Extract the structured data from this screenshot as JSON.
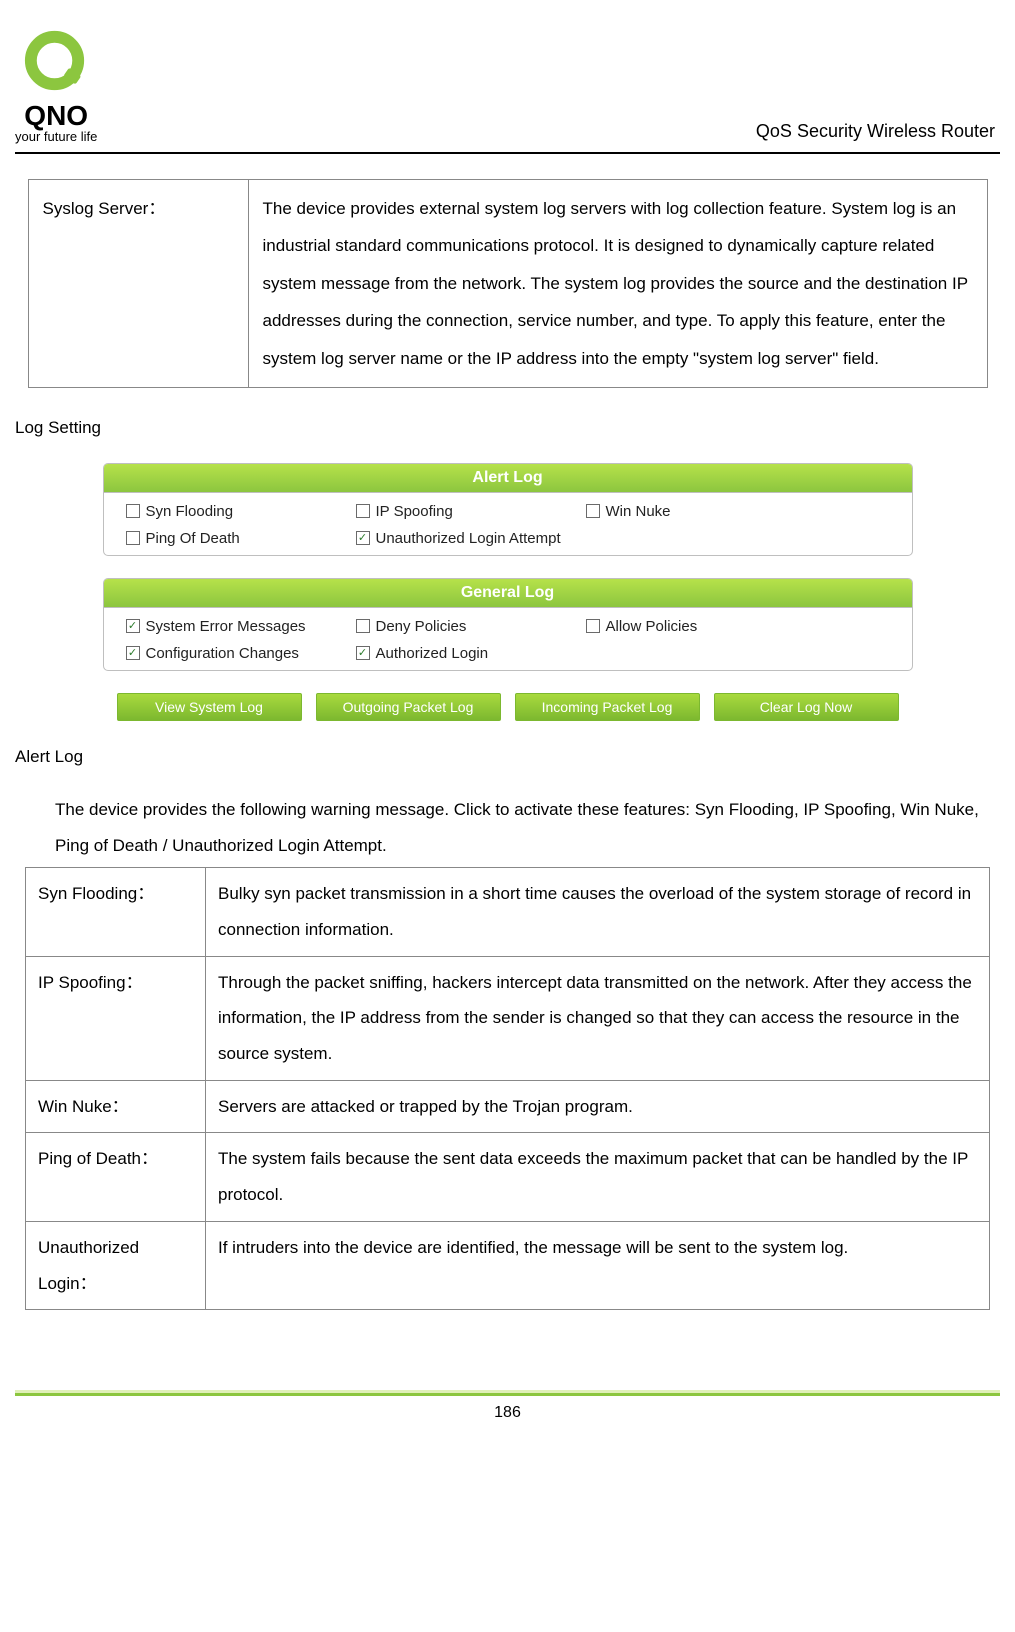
{
  "header": {
    "brand_word": "QNO",
    "tagline": "your future life",
    "title": "QoS Security Wireless Router"
  },
  "syslog_table": {
    "term": "Syslog Server：",
    "desc": "The device provides external system log servers with log collection feature. System log is an industrial standard communications protocol. It is designed to dynamically capture related system message from the network. The system log provides the source and the destination IP addresses during the connection, service number, and type. To apply this feature, enter the system log server name or the IP address into the empty \"system log server\" field."
  },
  "section_log_setting": "Log Setting",
  "alert_panel": {
    "title": "Alert Log",
    "items": [
      {
        "label": "Syn Flooding",
        "checked": false
      },
      {
        "label": "IP Spoofing",
        "checked": false
      },
      {
        "label": "Win Nuke",
        "checked": false
      },
      {
        "label": "Ping Of Death",
        "checked": false
      },
      {
        "label": "Unauthorized Login Attempt",
        "checked": true
      }
    ]
  },
  "general_panel": {
    "title": "General Log",
    "items": [
      {
        "label": "System Error Messages",
        "checked": true
      },
      {
        "label": "Deny Policies",
        "checked": false
      },
      {
        "label": "Allow Policies",
        "checked": false
      },
      {
        "label": "Configuration Changes",
        "checked": true
      },
      {
        "label": "Authorized Login",
        "checked": true
      }
    ]
  },
  "buttons": {
    "view": "View System Log",
    "out": "Outgoing Packet Log",
    "in": "Incoming Packet Log",
    "clear": "Clear Log Now"
  },
  "section_alert_log": "Alert Log",
  "alert_intro": "The device provides the following warning message. Click to activate these features: Syn Flooding, IP Spoofing, Win Nuke, Ping of Death / Unauthorized Login Attempt.",
  "alert_rows": [
    {
      "term": "Syn Flooding：",
      "desc": "Bulky syn packet transmission in a short time causes the overload of the system storage of record in connection information."
    },
    {
      "term": "IP Spoofing：",
      "desc": "Through the packet sniffing, hackers intercept data transmitted on the network. After they access the information, the IP address from the sender is changed so that they can access the resource in the source system."
    },
    {
      "term": "Win Nuke：",
      "desc": "Servers are attacked or trapped by the Trojan program."
    },
    {
      "term": "Ping of Death：",
      "desc": "The system fails because the sent data exceeds the maximum packet that can be handled by the IP protocol."
    },
    {
      "term": "Unauthorized Login：",
      "desc": "If intruders into the device are identified, the message will be sent to the system log."
    }
  ],
  "page_number": "186",
  "check_glyph": "✓"
}
